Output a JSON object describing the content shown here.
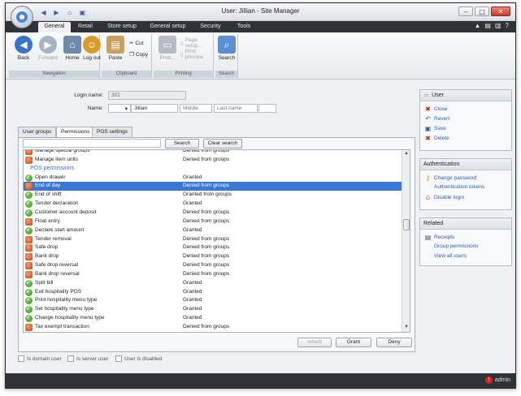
{
  "window": {
    "title": "User: Jillian - Site Manager"
  },
  "ribbon": {
    "tabs": [
      "General",
      "Retail",
      "Store setup",
      "General setup",
      "Security",
      "Tools"
    ],
    "groups": {
      "navigation": {
        "title": "Navigation",
        "back": "Back",
        "forward": "Forward",
        "home": "Home",
        "logout": "Log out"
      },
      "clipboard": {
        "title": "Clipboard",
        "paste": "Paste",
        "cut": "Cut",
        "copy": "Copy"
      },
      "printing": {
        "title": "Printing",
        "print": "Print...",
        "page_setup": "Page setup...",
        "print_preview": "Print preview"
      },
      "search": {
        "title": "Search",
        "search": "Search"
      }
    }
  },
  "form": {
    "login_label": "Login name:",
    "login_value": "302",
    "name_label": "Name:",
    "first_name": "Jillian",
    "middle_placeholder": "Middle",
    "last_placeholder": "Last name"
  },
  "content_tabs": [
    "User groups",
    "Permissions",
    "POS settings"
  ],
  "permissions": {
    "search_button": "Search",
    "clear_button": "Clear search",
    "rows": [
      {
        "name": "Manage special groups",
        "status": "Denied from groups",
        "icon": "denied"
      },
      {
        "name": "Manage item units",
        "status": "Denied from groups",
        "icon": "denied"
      },
      {
        "name": "POS permissions",
        "status": "",
        "icon": "section"
      },
      {
        "name": "Open drawer",
        "status": "Granted",
        "icon": "granted"
      },
      {
        "name": "End of day",
        "status": "Denied from groups",
        "icon": "denied",
        "selected": true
      },
      {
        "name": "End of shift",
        "status": "Granted from groups",
        "icon": "granted"
      },
      {
        "name": "Tender declaration",
        "status": "Granted",
        "icon": "granted"
      },
      {
        "name": "Customer account deposit",
        "status": "Denied from groups",
        "icon": "granted"
      },
      {
        "name": "Float entry",
        "status": "Denied from groups",
        "icon": "denied"
      },
      {
        "name": "Declare start amount",
        "status": "Granted",
        "icon": "granted"
      },
      {
        "name": "Tender removal",
        "status": "Denied from groups",
        "icon": "denied"
      },
      {
        "name": "Safe drop",
        "status": "Denied from groups",
        "icon": "denied"
      },
      {
        "name": "Bank drop",
        "status": "Denied from groups",
        "icon": "denied"
      },
      {
        "name": "Safe drop reversal",
        "status": "Denied from groups",
        "icon": "denied"
      },
      {
        "name": "Bank drop reversal",
        "status": "Denied from groups",
        "icon": "denied"
      },
      {
        "name": "Split bill",
        "status": "Granted",
        "icon": "granted"
      },
      {
        "name": "Exit hospitality POS",
        "status": "Granted",
        "icon": "granted"
      },
      {
        "name": "Print hospitality menu type",
        "status": "Granted",
        "icon": "granted"
      },
      {
        "name": "Set hospitality menu type",
        "status": "Granted",
        "icon": "granted"
      },
      {
        "name": "Change hospitality menu type",
        "status": "Granted",
        "icon": "granted"
      },
      {
        "name": "Tax exempt transaction",
        "status": "Denied from groups",
        "icon": "denied"
      }
    ],
    "inherit_button": "Inherit",
    "grant_button": "Grant",
    "deny_button": "Deny"
  },
  "checkboxes": [
    "Is domain user",
    "Is server user",
    "User is disabled"
  ],
  "side": {
    "user": {
      "title": "User",
      "items": [
        "Close",
        "Revert",
        "Save",
        "Delete"
      ]
    },
    "authentication": {
      "title": "Authentication",
      "items": [
        "Change password",
        "Authentication tokens",
        "Disable login"
      ]
    },
    "related": {
      "title": "Related",
      "items": [
        "Receipts",
        "Group permissions",
        "View all users"
      ]
    }
  },
  "status": {
    "user": "admin"
  }
}
